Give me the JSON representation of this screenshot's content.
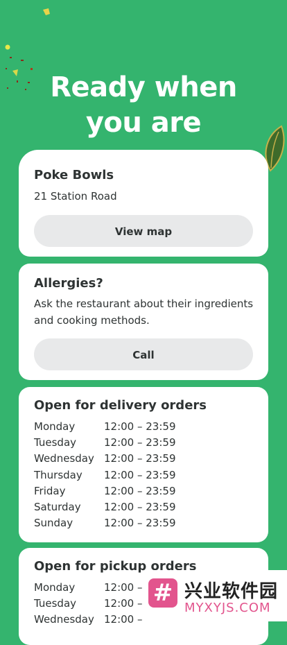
{
  "hero": {
    "line1": "Ready when",
    "line2": "you are"
  },
  "restaurant": {
    "name": "Poke Bowls",
    "address": "21 Station Road",
    "view_map_label": "View map"
  },
  "allergies": {
    "title": "Allergies?",
    "text": "Ask the restaurant about their ingredients and cooking methods.",
    "call_label": "Call"
  },
  "delivery": {
    "title": "Open for delivery orders",
    "hours": [
      {
        "day": "Monday",
        "time": "12:00 – 23:59"
      },
      {
        "day": "Tuesday",
        "time": "12:00 – 23:59"
      },
      {
        "day": "Wednesday",
        "time": "12:00 – 23:59"
      },
      {
        "day": "Thursday",
        "time": "12:00 – 23:59"
      },
      {
        "day": "Friday",
        "time": "12:00 – 23:59"
      },
      {
        "day": "Saturday",
        "time": "12:00 – 23:59"
      },
      {
        "day": "Sunday",
        "time": "12:00 – 23:59"
      }
    ]
  },
  "pickup": {
    "title": "Open for pickup orders",
    "hours": [
      {
        "day": "Monday",
        "time": "12:00 –"
      },
      {
        "day": "Tuesday",
        "time": "12:00 –"
      },
      {
        "day": "Wednesday",
        "time": "12:00 –"
      }
    ]
  },
  "watermark": {
    "logo": "#",
    "cn": "兴业软件园",
    "en": "MYXYJS.COM"
  },
  "colors": {
    "background": "#34b46e",
    "card": "#ffffff",
    "button": "#e8e9ea",
    "text": "#2e3333",
    "watermark_accent": "#e2548d"
  },
  "icons": {
    "leaf": "leaf-icon",
    "confetti": "confetti-decoration"
  }
}
